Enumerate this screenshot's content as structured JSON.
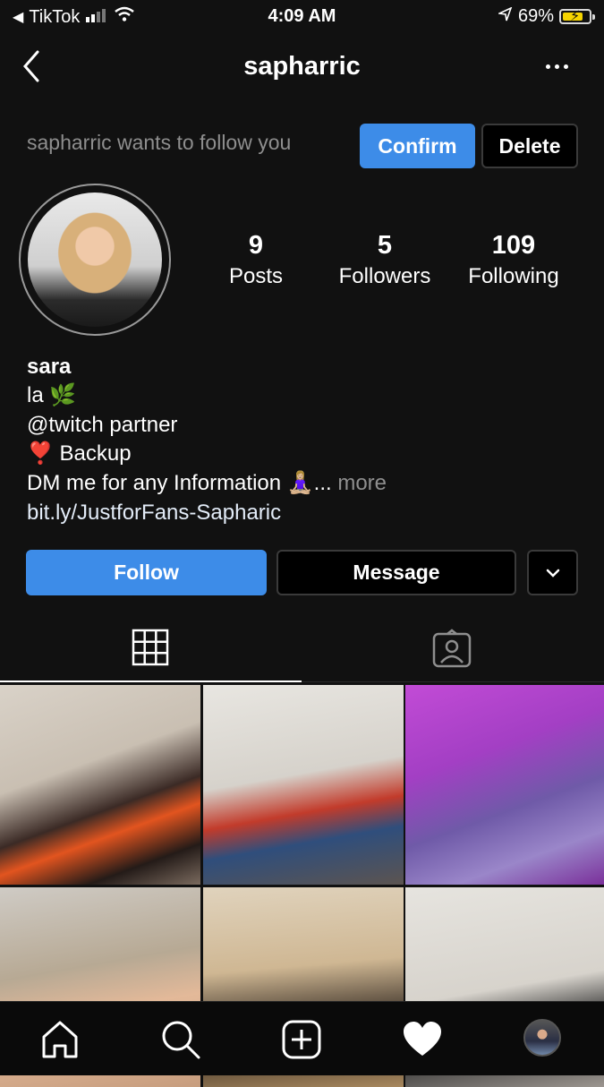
{
  "status_bar": {
    "back_app": "TikTok",
    "time": "4:09 AM",
    "battery": "69%",
    "battery_level": 0.69,
    "icons": [
      "back-arrow-icon",
      "signal-icon",
      "wifi-icon",
      "location-icon",
      "battery-charging-icon"
    ]
  },
  "header": {
    "title": "sapharric",
    "back_icon": "chevron-left-icon",
    "more_icon": "more-dots-icon"
  },
  "follow_request": {
    "text": "sapharric wants to follow you",
    "confirm_label": "Confirm",
    "delete_label": "Delete",
    "colors": {
      "confirm": "#3d8ce8"
    }
  },
  "profile": {
    "stats": [
      {
        "value": "9",
        "label": "Posts"
      },
      {
        "value": "5",
        "label": "Followers"
      },
      {
        "value": "109",
        "label": "Following"
      }
    ],
    "name": "sara",
    "bio": {
      "line1": "la 🌿",
      "line2": "@twitch partner",
      "line3": "❣️ Backup",
      "line4": "DM me for any Information 🧘🏼‍♀️...",
      "more": " more",
      "link": "bit.ly/JustforFans-Sapharic"
    }
  },
  "actions": {
    "follow_label": "Follow",
    "message_label": "Message",
    "dropdown_icon": "chevron-down-icon"
  },
  "tabs": [
    {
      "icon": "grid-icon",
      "active": true
    },
    {
      "icon": "tagged-person-icon",
      "active": false
    }
  ],
  "bottom_nav": [
    "home-icon",
    "search-icon",
    "add-post-icon",
    "heart-icon",
    "profile-avatar"
  ]
}
